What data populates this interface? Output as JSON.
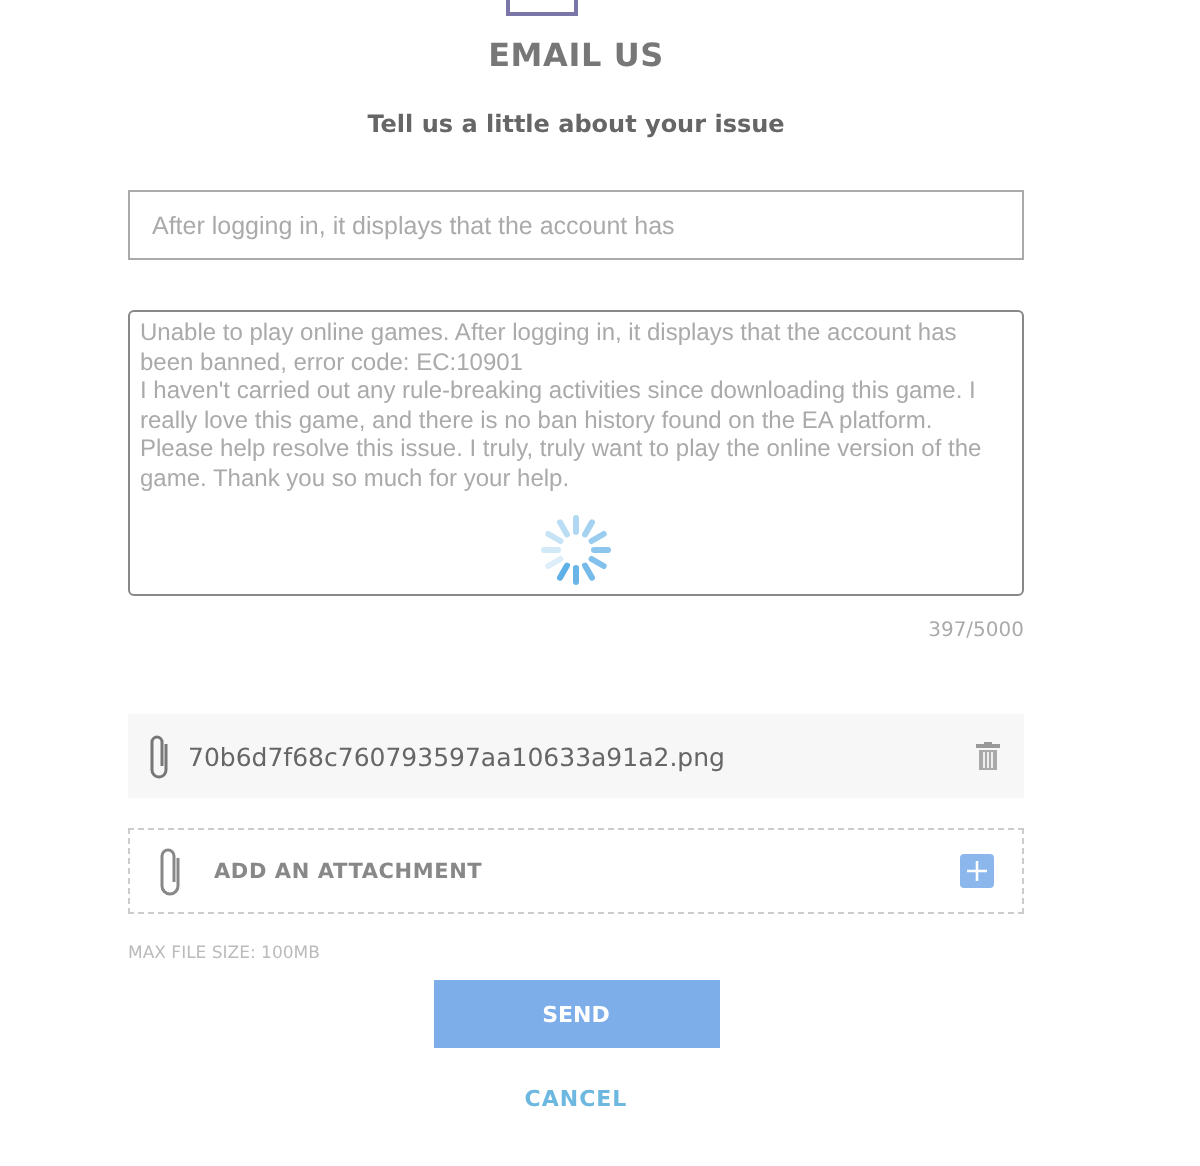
{
  "title": "EMAIL US",
  "subtitle": "Tell us a little about your issue",
  "subject": {
    "value": "After logging in, it displays that the account has"
  },
  "message": {
    "value": "Unable to play online games. After logging in, it displays that the account has been banned, error code: EC:10901\nI haven't carried out any rule-breaking activities since downloading this game. I really love this game, and there is no ban history found on the EA platform. Please help resolve this issue. I truly, truly want to play the online version of the game. Thank you so much for your help.",
    "loading": true,
    "counter": "397/5000"
  },
  "attachments": [
    {
      "name": "70b6d7f68c760793597aa10633a91a2.png"
    }
  ],
  "add_attachment": "ADD AN ATTACHMENT",
  "max_size": "MAX FILE SIZE: 100MB",
  "send": "SEND",
  "cancel": "CANCEL"
}
